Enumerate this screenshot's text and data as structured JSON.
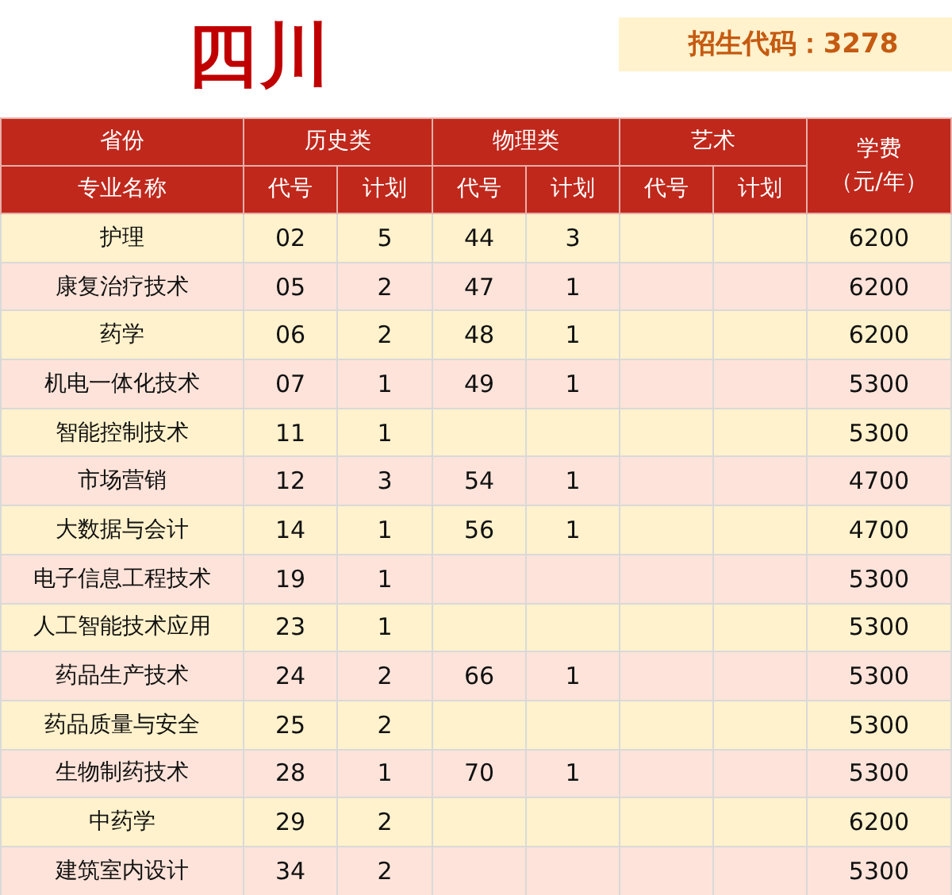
{
  "title": "四川",
  "code_badge": "招生代码：3278",
  "header": {
    "province": "省份",
    "major": "专业名称",
    "groups": [
      {
        "label": "历史类",
        "code": "代号",
        "plan": "计划"
      },
      {
        "label": "物理类",
        "code": "代号",
        "plan": "计划"
      },
      {
        "label": "艺术",
        "code": "代号",
        "plan": "计划"
      }
    ],
    "fee": "学费",
    "fee_unit": "（元/年）"
  },
  "rows": [
    {
      "name": "护理",
      "history": [
        "02",
        "5"
      ],
      "physics": [
        "44",
        "3"
      ],
      "fee": "6200"
    },
    {
      "name": "康复治疗技术",
      "history": [
        "05",
        "2"
      ],
      "physics": [
        "47",
        "1"
      ],
      "fee": "6200"
    },
    {
      "name": "药学",
      "history": [
        "06",
        "2"
      ],
      "physics": [
        "48",
        "1"
      ],
      "fee": "6200"
    },
    {
      "name": "机电一体化技术",
      "history": [
        "07",
        "1"
      ],
      "physics": [
        "49",
        "1"
      ],
      "fee": "5300"
    },
    {
      "name": "智能控制技术",
      "history": [
        "11",
        "1"
      ],
      "physics": [],
      "fee": "5300"
    },
    {
      "name": "市场营销",
      "history": [
        "12",
        "3"
      ],
      "physics": [
        "54",
        "1"
      ],
      "fee": "4700"
    },
    {
      "name": "大数据与会计",
      "history": [
        "14",
        "1"
      ],
      "physics": [
        "56",
        "1"
      ],
      "fee": "4700"
    },
    {
      "name": "电子信息工程技术",
      "history": [
        "19",
        "1"
      ],
      "physics": [],
      "fee": "5300"
    },
    {
      "name": "人工智能技术应用",
      "history": [
        "23",
        "1"
      ],
      "physics": [],
      "fee": "5300"
    },
    {
      "name": "药品生产技术",
      "history": [
        "24",
        "2"
      ],
      "physics": [
        "66",
        "1"
      ],
      "fee": "5300"
    },
    {
      "name": "药品质量与安全",
      "history": [
        "25",
        "2"
      ],
      "physics": [],
      "fee": "5300"
    },
    {
      "name": "生物制药技术",
      "history": [
        "28",
        "1"
      ],
      "physics": [
        "70",
        "1"
      ],
      "fee": "5300"
    },
    {
      "name": "中药学",
      "history": [
        "29",
        "2"
      ],
      "physics": [],
      "fee": "6200"
    },
    {
      "name": "建筑室内设计",
      "history": [
        "34",
        "2"
      ],
      "physics": [],
      "fee": "5300"
    }
  ]
}
